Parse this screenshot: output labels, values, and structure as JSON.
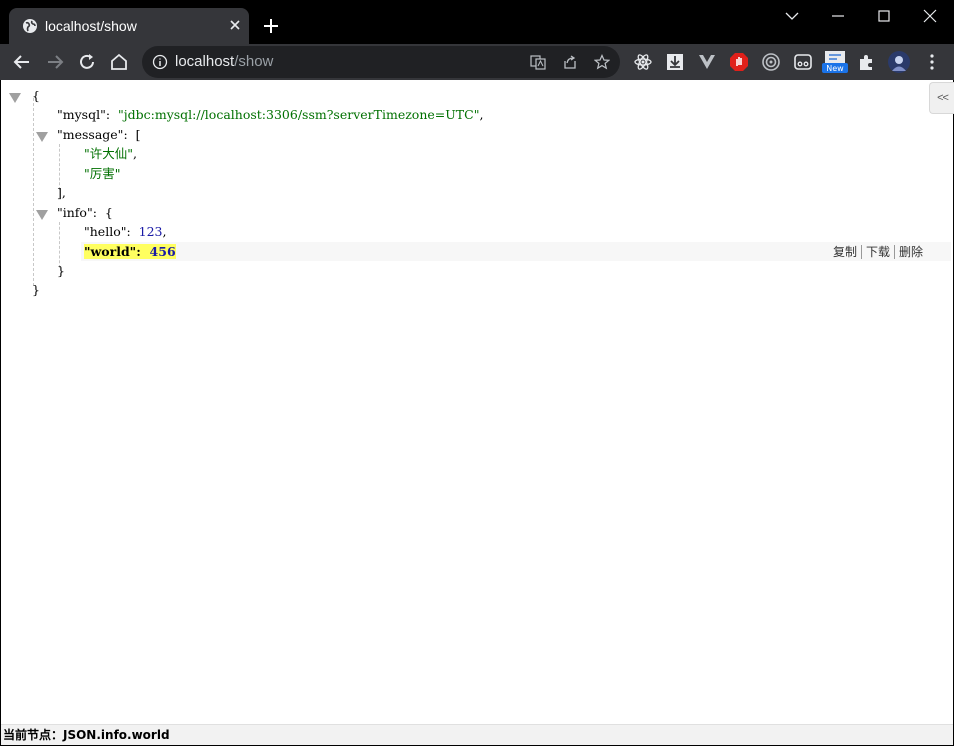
{
  "tab": {
    "title": "localhost/show"
  },
  "address_bar": {
    "host": "localhost",
    "path": "/show"
  },
  "json_viewer": {
    "open_brace": "{",
    "close_brace": "}",
    "mysql_key": "\"mysql\"",
    "mysql_value": "\"jdbc:mysql://localhost:3306/ssm?serverTimezone=UTC\"",
    "message_key": "\"message\"",
    "open_bracket": "[",
    "message_items": [
      "\"许大仙\"",
      "\"厉害\""
    ],
    "close_bracket": "],",
    "info_key": "\"info\"",
    "hello_key": "\"hello\"",
    "hello_value": "123",
    "world_key": "\"world\"",
    "world_value": "456",
    "colon": ":",
    "comma": ",",
    "collapse_label": "<<"
  },
  "row_actions": {
    "copy": "复制",
    "download": "下载",
    "delete": "删除"
  },
  "status": {
    "text": "当前节点：JSON.info.world"
  },
  "colors": {
    "string": "#007000",
    "number": "#1a1aa6",
    "highlight": "#ffff60"
  }
}
